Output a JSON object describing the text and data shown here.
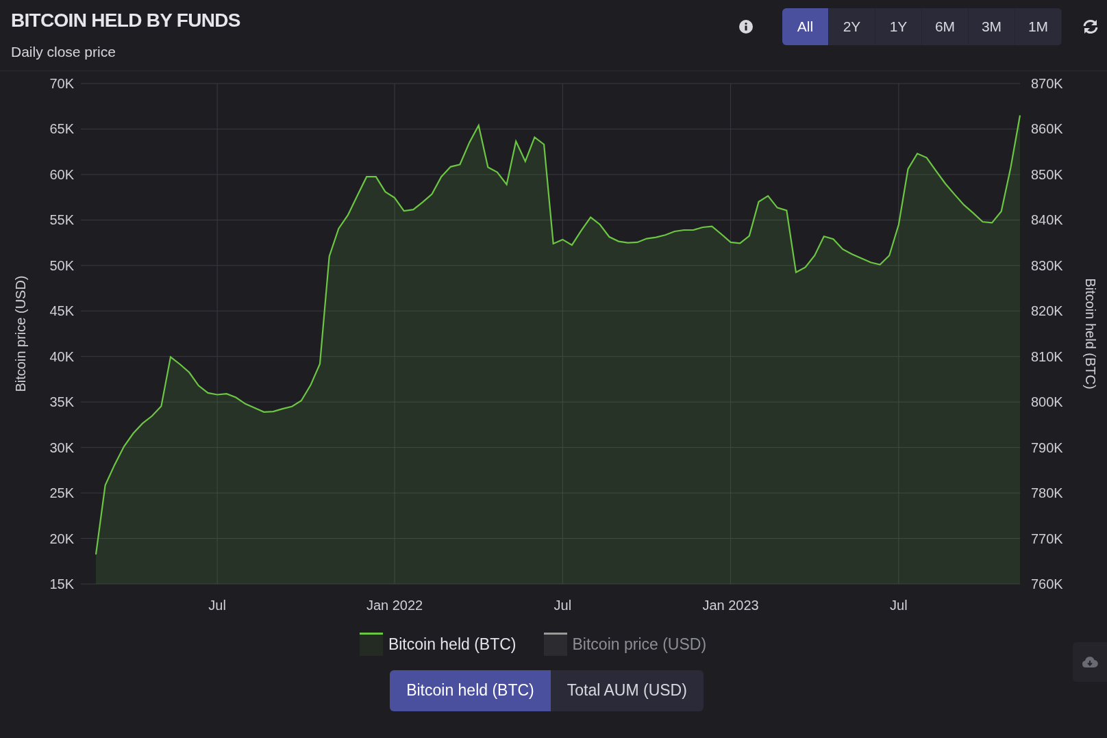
{
  "header": {
    "title": "BITCOIN HELD BY FUNDS",
    "subtitle": "Daily close price"
  },
  "ranges": [
    {
      "label": "All",
      "selected": true
    },
    {
      "label": "2Y",
      "selected": false
    },
    {
      "label": "1Y",
      "selected": false
    },
    {
      "label": "6M",
      "selected": false
    },
    {
      "label": "3M",
      "selected": false
    },
    {
      "label": "1M",
      "selected": false
    }
  ],
  "left_axis": {
    "label": "Bitcoin price (USD)",
    "ticks": [
      "70K",
      "65K",
      "60K",
      "55K",
      "50K",
      "45K",
      "40K",
      "35K",
      "30K",
      "25K",
      "20K",
      "15K"
    ]
  },
  "chart_data": {
    "type": "area",
    "grid": true,
    "ylabel": "Bitcoin held (BTC)",
    "ylim": [
      760,
      870
    ],
    "yticks": [
      {
        "value": 870,
        "label": "870K"
      },
      {
        "value": 860,
        "label": "860K"
      },
      {
        "value": 850,
        "label": "850K"
      },
      {
        "value": 840,
        "label": "840K"
      },
      {
        "value": 830,
        "label": "830K"
      },
      {
        "value": 820,
        "label": "820K"
      },
      {
        "value": 810,
        "label": "810K"
      },
      {
        "value": 800,
        "label": "800K"
      },
      {
        "value": 790,
        "label": "790K"
      },
      {
        "value": 780,
        "label": "780K"
      },
      {
        "value": 770,
        "label": "770K"
      },
      {
        "value": 760,
        "label": "760K"
      }
    ],
    "categories": [
      null,
      null,
      null,
      null,
      null,
      null,
      null,
      null,
      null,
      null,
      null,
      null,
      null,
      "Jul",
      null,
      null,
      null,
      null,
      null,
      null,
      null,
      null,
      null,
      null,
      null,
      null,
      null,
      null,
      null,
      null,
      null,
      null,
      "Jan 2022",
      null,
      null,
      null,
      null,
      null,
      null,
      null,
      null,
      null,
      null,
      null,
      null,
      null,
      null,
      null,
      null,
      null,
      "Jul",
      null,
      null,
      null,
      null,
      null,
      null,
      null,
      null,
      null,
      null,
      null,
      null,
      null,
      null,
      null,
      null,
      null,
      "Jan 2023",
      null,
      null,
      null,
      null,
      null,
      null,
      null,
      null,
      null,
      null,
      null,
      null,
      null,
      null,
      null,
      null,
      null,
      "Jul",
      null,
      null,
      null,
      null,
      null,
      null,
      null,
      null,
      null,
      null,
      null,
      null,
      null
    ],
    "series": [
      {
        "name": "Bitcoin held (BTC)",
        "color": "#6cc644",
        "values": [
          766.5,
          781.7,
          786.2,
          790.2,
          793.1,
          795.3,
          796.9,
          799.1,
          809.9,
          808.3,
          806.5,
          803.6,
          802,
          801.6,
          801.8,
          801,
          799.6,
          798.7,
          797.8,
          797.9,
          798.5,
          799,
          800.3,
          803.7,
          808.4,
          832,
          838.1,
          841.1,
          845.3,
          849.5,
          849.5,
          846.2,
          844.9,
          842,
          842.3,
          843.9,
          845.7,
          849.5,
          851.7,
          852.2,
          857,
          860.8,
          851.6,
          850.5,
          847.8,
          857.3,
          852.9,
          858.2,
          856.6,
          834.8,
          835.7,
          834.5,
          837.7,
          840.6,
          839,
          836.3,
          835.3,
          835,
          835.1,
          835.9,
          836.2,
          836.7,
          837.5,
          837.8,
          837.8,
          838.4,
          838.6,
          836.9,
          835.1,
          834.9,
          836.5,
          844,
          845.3,
          842.7,
          842.1,
          828.5,
          829.6,
          832.2,
          836.4,
          835.8,
          833.6,
          832.5,
          831.6,
          830.7,
          830.2,
          832.2,
          839,
          851.2,
          854.6,
          853.7,
          850.8,
          848,
          845.6,
          843.3,
          841.5,
          839.6,
          839.4,
          841.9,
          851.5,
          863
        ]
      }
    ]
  },
  "legend": [
    {
      "kind": "series",
      "visible": true
    },
    {
      "kind": "static",
      "label": "Bitcoin price (USD)",
      "color": "#9a9a9a",
      "visible": false
    }
  ],
  "metrics": [
    {
      "label": "Bitcoin held (BTC)",
      "selected": true
    },
    {
      "label": "Total AUM (USD)",
      "selected": false
    }
  ]
}
